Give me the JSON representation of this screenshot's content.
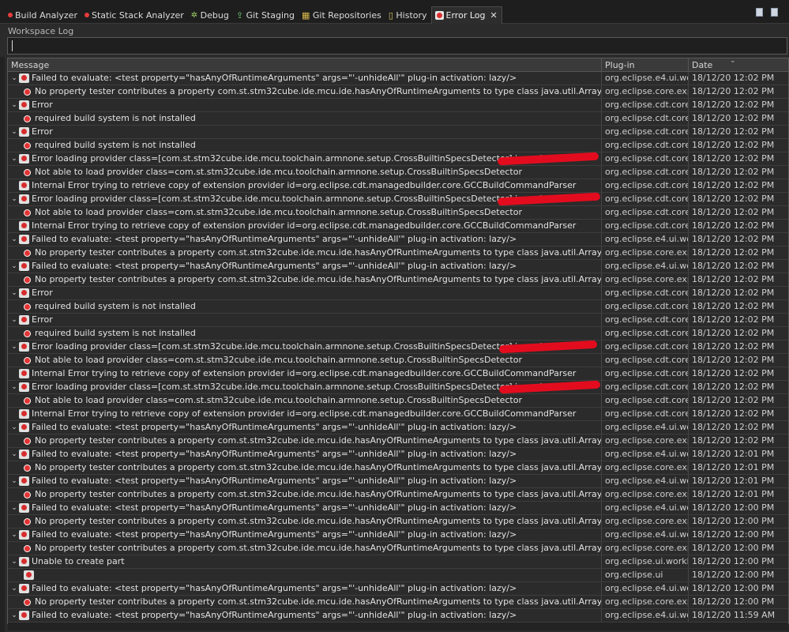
{
  "tabs": [
    {
      "label": "Build Analyzer",
      "icon": "red-dot-icon",
      "active": false
    },
    {
      "label": "Static Stack Analyzer",
      "icon": "red-dot-icon",
      "active": false
    },
    {
      "label": "Debug",
      "icon": "debug-icon",
      "active": false
    },
    {
      "label": "Git Staging",
      "icon": "git-staging-icon",
      "active": false
    },
    {
      "label": "Git Repositories",
      "icon": "git-repositories-icon",
      "active": false
    },
    {
      "label": "History",
      "icon": "history-icon",
      "active": false
    },
    {
      "label": "Error Log",
      "icon": "error-log-icon",
      "active": true
    }
  ],
  "workspace_label": "Workspace Log",
  "filter": {
    "value": ""
  },
  "columns": {
    "message": "Message",
    "plugin": "Plug-in",
    "date": "Date"
  },
  "rows": [
    {
      "level": 0,
      "twisty": "expanded",
      "message": "Failed to evaluate: <test property=\"hasAnyOfRuntimeArguments\" args=\"'-unhideAll'\" plug-in activation: lazy/>",
      "plugin": "org.eclipse.e4.ui.wo...",
      "date": "18/12/20 12:02 PM"
    },
    {
      "level": 1,
      "twisty": "none",
      "message": "No property tester contributes a property com.st.stm32cube.ide.mcu.ide.hasAnyOfRuntimeArguments to type class java.util.Arrays$ArrayList",
      "plugin": "org.eclipse.core.exp...",
      "date": "18/12/20 12:02 PM"
    },
    {
      "level": 0,
      "twisty": "expanded",
      "message": "Error",
      "plugin": "org.eclipse.cdt.core",
      "date": "18/12/20 12:02 PM"
    },
    {
      "level": 1,
      "twisty": "none",
      "message": "required build system is not installed",
      "plugin": "org.eclipse.cdt.core",
      "date": "18/12/20 12:02 PM"
    },
    {
      "level": 0,
      "twisty": "expanded",
      "message": "Error",
      "plugin": "org.eclipse.cdt.core",
      "date": "18/12/20 12:02 PM"
    },
    {
      "level": 1,
      "twisty": "none",
      "message": "required build system is not installed",
      "plugin": "org.eclipse.cdt.core",
      "date": "18/12/20 12:02 PM"
    },
    {
      "level": 0,
      "twisty": "expanded",
      "message": "Error loading provider class=[com.st.stm32cube.ide.mcu.toolchain.armnone.setup.CrossBuiltinSpecsDetector] in project=",
      "plugin": "org.eclipse.cdt.core",
      "date": "18/12/20 12:02 PM",
      "redacted": true
    },
    {
      "level": 1,
      "twisty": "none",
      "message": "Not able to load provider class=com.st.stm32cube.ide.mcu.toolchain.armnone.setup.CrossBuiltinSpecsDetector",
      "plugin": "org.eclipse.cdt.core",
      "date": "18/12/20 12:02 PM"
    },
    {
      "level": 0,
      "twisty": "none",
      "message": "Internal Error trying to retrieve copy of extension provider id=org.eclipse.cdt.managedbuilder.core.GCCBuildCommandParser",
      "plugin": "org.eclipse.cdt.core",
      "date": "18/12/20 12:02 PM"
    },
    {
      "level": 0,
      "twisty": "expanded",
      "message": "Error loading provider class=[com.st.stm32cube.ide.mcu.toolchain.armnone.setup.CrossBuiltinSpecsDetector] in project=",
      "plugin": "org.eclipse.cdt.core",
      "date": "18/12/20 12:02 PM",
      "redacted": true
    },
    {
      "level": 1,
      "twisty": "none",
      "message": "Not able to load provider class=com.st.stm32cube.ide.mcu.toolchain.armnone.setup.CrossBuiltinSpecsDetector",
      "plugin": "org.eclipse.cdt.core",
      "date": "18/12/20 12:02 PM"
    },
    {
      "level": 0,
      "twisty": "none",
      "message": "Internal Error trying to retrieve copy of extension provider id=org.eclipse.cdt.managedbuilder.core.GCCBuildCommandParser",
      "plugin": "org.eclipse.cdt.core",
      "date": "18/12/20 12:02 PM"
    },
    {
      "level": 0,
      "twisty": "expanded",
      "message": "Failed to evaluate: <test property=\"hasAnyOfRuntimeArguments\" args=\"'-unhideAll'\" plug-in activation: lazy/>",
      "plugin": "org.eclipse.e4.ui.wo...",
      "date": "18/12/20 12:02 PM"
    },
    {
      "level": 1,
      "twisty": "none",
      "message": "No property tester contributes a property com.st.stm32cube.ide.mcu.ide.hasAnyOfRuntimeArguments to type class java.util.Arrays$ArrayList",
      "plugin": "org.eclipse.core.exp...",
      "date": "18/12/20 12:02 PM"
    },
    {
      "level": 0,
      "twisty": "expanded",
      "message": "Failed to evaluate: <test property=\"hasAnyOfRuntimeArguments\" args=\"'-unhideAll'\" plug-in activation: lazy/>",
      "plugin": "org.eclipse.e4.ui.wo...",
      "date": "18/12/20 12:02 PM"
    },
    {
      "level": 1,
      "twisty": "none",
      "message": "No property tester contributes a property com.st.stm32cube.ide.mcu.ide.hasAnyOfRuntimeArguments to type class java.util.Arrays$ArrayList",
      "plugin": "org.eclipse.core.exp...",
      "date": "18/12/20 12:02 PM"
    },
    {
      "level": 0,
      "twisty": "expanded",
      "message": "Error",
      "plugin": "org.eclipse.cdt.core",
      "date": "18/12/20 12:02 PM"
    },
    {
      "level": 1,
      "twisty": "none",
      "message": "required build system is not installed",
      "plugin": "org.eclipse.cdt.core",
      "date": "18/12/20 12:02 PM"
    },
    {
      "level": 0,
      "twisty": "expanded",
      "message": "Error",
      "plugin": "org.eclipse.cdt.core",
      "date": "18/12/20 12:02 PM"
    },
    {
      "level": 1,
      "twisty": "none",
      "message": "required build system is not installed",
      "plugin": "org.eclipse.cdt.core",
      "date": "18/12/20 12:02 PM"
    },
    {
      "level": 0,
      "twisty": "expanded",
      "message": "Error loading provider class=[com.st.stm32cube.ide.mcu.toolchain.armnone.setup.CrossBuiltinSpecsDetector] in project=",
      "plugin": "org.eclipse.cdt.core",
      "date": "18/12/20 12:02 PM",
      "redacted": true
    },
    {
      "level": 1,
      "twisty": "none",
      "message": "Not able to load provider class=com.st.stm32cube.ide.mcu.toolchain.armnone.setup.CrossBuiltinSpecsDetector",
      "plugin": "org.eclipse.cdt.core",
      "date": "18/12/20 12:02 PM"
    },
    {
      "level": 0,
      "twisty": "none",
      "message": "Internal Error trying to retrieve copy of extension provider id=org.eclipse.cdt.managedbuilder.core.GCCBuildCommandParser",
      "plugin": "org.eclipse.cdt.core",
      "date": "18/12/20 12:02 PM"
    },
    {
      "level": 0,
      "twisty": "expanded",
      "message": "Error loading provider class=[com.st.stm32cube.ide.mcu.toolchain.armnone.setup.CrossBuiltinSpecsDetector] in project=",
      "plugin": "org.eclipse.cdt.core",
      "date": "18/12/20 12:02 PM",
      "redacted": true
    },
    {
      "level": 1,
      "twisty": "none",
      "message": "Not able to load provider class=com.st.stm32cube.ide.mcu.toolchain.armnone.setup.CrossBuiltinSpecsDetector",
      "plugin": "org.eclipse.cdt.core",
      "date": "18/12/20 12:02 PM"
    },
    {
      "level": 0,
      "twisty": "none",
      "message": "Internal Error trying to retrieve copy of extension provider id=org.eclipse.cdt.managedbuilder.core.GCCBuildCommandParser",
      "plugin": "org.eclipse.cdt.core",
      "date": "18/12/20 12:02 PM"
    },
    {
      "level": 0,
      "twisty": "expanded",
      "message": "Failed to evaluate: <test property=\"hasAnyOfRuntimeArguments\" args=\"'-unhideAll'\" plug-in activation: lazy/>",
      "plugin": "org.eclipse.e4.ui.wo...",
      "date": "18/12/20 12:02 PM"
    },
    {
      "level": 1,
      "twisty": "none",
      "message": "No property tester contributes a property com.st.stm32cube.ide.mcu.ide.hasAnyOfRuntimeArguments to type class java.util.Arrays$ArrayList",
      "plugin": "org.eclipse.core.exp...",
      "date": "18/12/20 12:02 PM"
    },
    {
      "level": 0,
      "twisty": "expanded",
      "message": "Failed to evaluate: <test property=\"hasAnyOfRuntimeArguments\" args=\"'-unhideAll'\" plug-in activation: lazy/>",
      "plugin": "org.eclipse.e4.ui.wo...",
      "date": "18/12/20 12:01 PM"
    },
    {
      "level": 1,
      "twisty": "none",
      "message": "No property tester contributes a property com.st.stm32cube.ide.mcu.ide.hasAnyOfRuntimeArguments to type class java.util.Arrays$ArrayList",
      "plugin": "org.eclipse.core.exp...",
      "date": "18/12/20 12:01 PM"
    },
    {
      "level": 0,
      "twisty": "expanded",
      "message": "Failed to evaluate: <test property=\"hasAnyOfRuntimeArguments\" args=\"'-unhideAll'\" plug-in activation: lazy/>",
      "plugin": "org.eclipse.e4.ui.wo...",
      "date": "18/12/20 12:01 PM"
    },
    {
      "level": 1,
      "twisty": "none",
      "message": "No property tester contributes a property com.st.stm32cube.ide.mcu.ide.hasAnyOfRuntimeArguments to type class java.util.Arrays$ArrayList",
      "plugin": "org.eclipse.core.exp...",
      "date": "18/12/20 12:01 PM"
    },
    {
      "level": 0,
      "twisty": "expanded",
      "message": "Failed to evaluate: <test property=\"hasAnyOfRuntimeArguments\" args=\"'-unhideAll'\" plug-in activation: lazy/>",
      "plugin": "org.eclipse.e4.ui.wo...",
      "date": "18/12/20 12:00 PM"
    },
    {
      "level": 1,
      "twisty": "none",
      "message": "No property tester contributes a property com.st.stm32cube.ide.mcu.ide.hasAnyOfRuntimeArguments to type class java.util.Arrays$ArrayList",
      "plugin": "org.eclipse.core.exp...",
      "date": "18/12/20 12:00 PM"
    },
    {
      "level": 0,
      "twisty": "expanded",
      "message": "Failed to evaluate: <test property=\"hasAnyOfRuntimeArguments\" args=\"'-unhideAll'\" plug-in activation: lazy/>",
      "plugin": "org.eclipse.e4.ui.wo...",
      "date": "18/12/20 12:00 PM"
    },
    {
      "level": 1,
      "twisty": "none",
      "message": "No property tester contributes a property com.st.stm32cube.ide.mcu.ide.hasAnyOfRuntimeArguments to type class java.util.Arrays$ArrayList",
      "plugin": "org.eclipse.core.exp...",
      "date": "18/12/20 12:00 PM"
    },
    {
      "level": 0,
      "twisty": "expanded",
      "message": "Unable to create part",
      "plugin": "org.eclipse.ui.workb...",
      "date": "18/12/20 12:00 PM"
    },
    {
      "level": 1,
      "twisty": "none",
      "message": "",
      "plugin": "org.eclipse.ui",
      "date": "18/12/20 12:00 PM",
      "icon": "bundle"
    },
    {
      "level": 0,
      "twisty": "expanded",
      "message": "Failed to evaluate: <test property=\"hasAnyOfRuntimeArguments\" args=\"'-unhideAll'\" plug-in activation: lazy/>",
      "plugin": "org.eclipse.e4.ui.wo...",
      "date": "18/12/20 12:00 PM"
    },
    {
      "level": 1,
      "twisty": "none",
      "message": "No property tester contributes a property com.st.stm32cube.ide.mcu.ide.hasAnyOfRuntimeArguments to type class java.util.Arrays$ArrayList",
      "plugin": "org.eclipse.core.exp...",
      "date": "18/12/20 12:00 PM"
    },
    {
      "level": 0,
      "twisty": "expanded",
      "message": "Failed to evaluate: <test property=\"hasAnyOfRuntimeArguments\" args=\"'-unhideAll'\" plug-in activation: lazy/>",
      "plugin": "org.eclipse.e4.ui.wo...",
      "date": "18/12/20 11:59 AM"
    }
  ]
}
